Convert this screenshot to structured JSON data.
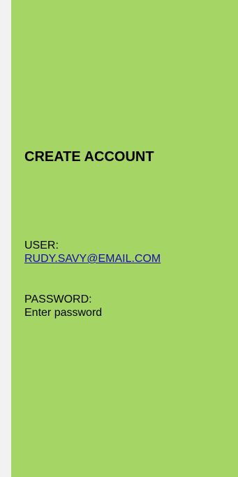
{
  "form": {
    "title": "CREATE ACCOUNT",
    "user_label": "USER:",
    "user_value": "RUDY.SAVY@EMAIL.COM",
    "password_label": "PASSWORD:",
    "password_placeholder": "Enter password"
  },
  "colors": {
    "page_background": "#f2f2f2",
    "panel_background": "#a5d665",
    "link": "#1a0dab",
    "text": "#000000"
  }
}
